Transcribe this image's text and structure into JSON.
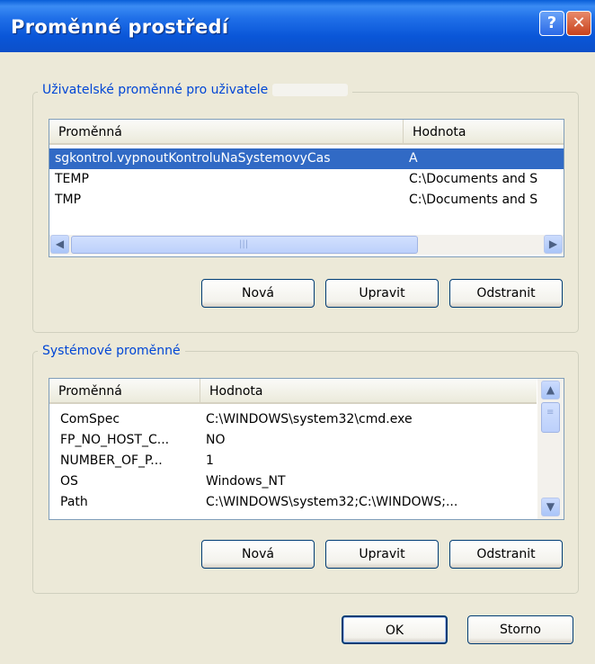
{
  "window": {
    "title": "Proměnné prostředí",
    "help_glyph": "?",
    "close_glyph": "✕"
  },
  "user_vars": {
    "group_label": "Uživatelské proměnné pro uživatele",
    "columns": [
      "Proměnná",
      "Hodnota"
    ],
    "rows": [
      {
        "name": "sgkontrol.vypnoutKontroluNaSystemovyCas",
        "value": "A"
      },
      {
        "name": "TEMP",
        "value": "C:\\Documents and S"
      },
      {
        "name": "TMP",
        "value": "C:\\Documents and S"
      }
    ],
    "scroll_left": "◀",
    "scroll_right": "▶",
    "buttons": {
      "new": "Nová",
      "edit": "Upravit",
      "delete": "Odstranit"
    }
  },
  "system_vars": {
    "group_label": "Systémové proměnné",
    "columns": [
      "Proměnná",
      "Hodnota"
    ],
    "rows": [
      {
        "name": "ComSpec",
        "value": "C:\\WINDOWS\\system32\\cmd.exe"
      },
      {
        "name": "FP_NO_HOST_C...",
        "value": "NO"
      },
      {
        "name": "NUMBER_OF_P...",
        "value": "1"
      },
      {
        "name": "OS",
        "value": "Windows_NT"
      },
      {
        "name": "Path",
        "value": "C:\\WINDOWS\\system32;C:\\WINDOWS;..."
      }
    ],
    "scroll_up": "▲",
    "scroll_down": "▼",
    "buttons": {
      "new": "Nová",
      "edit": "Upravit",
      "delete": "Odstranit"
    }
  },
  "footer": {
    "ok": "OK",
    "cancel": "Storno"
  }
}
